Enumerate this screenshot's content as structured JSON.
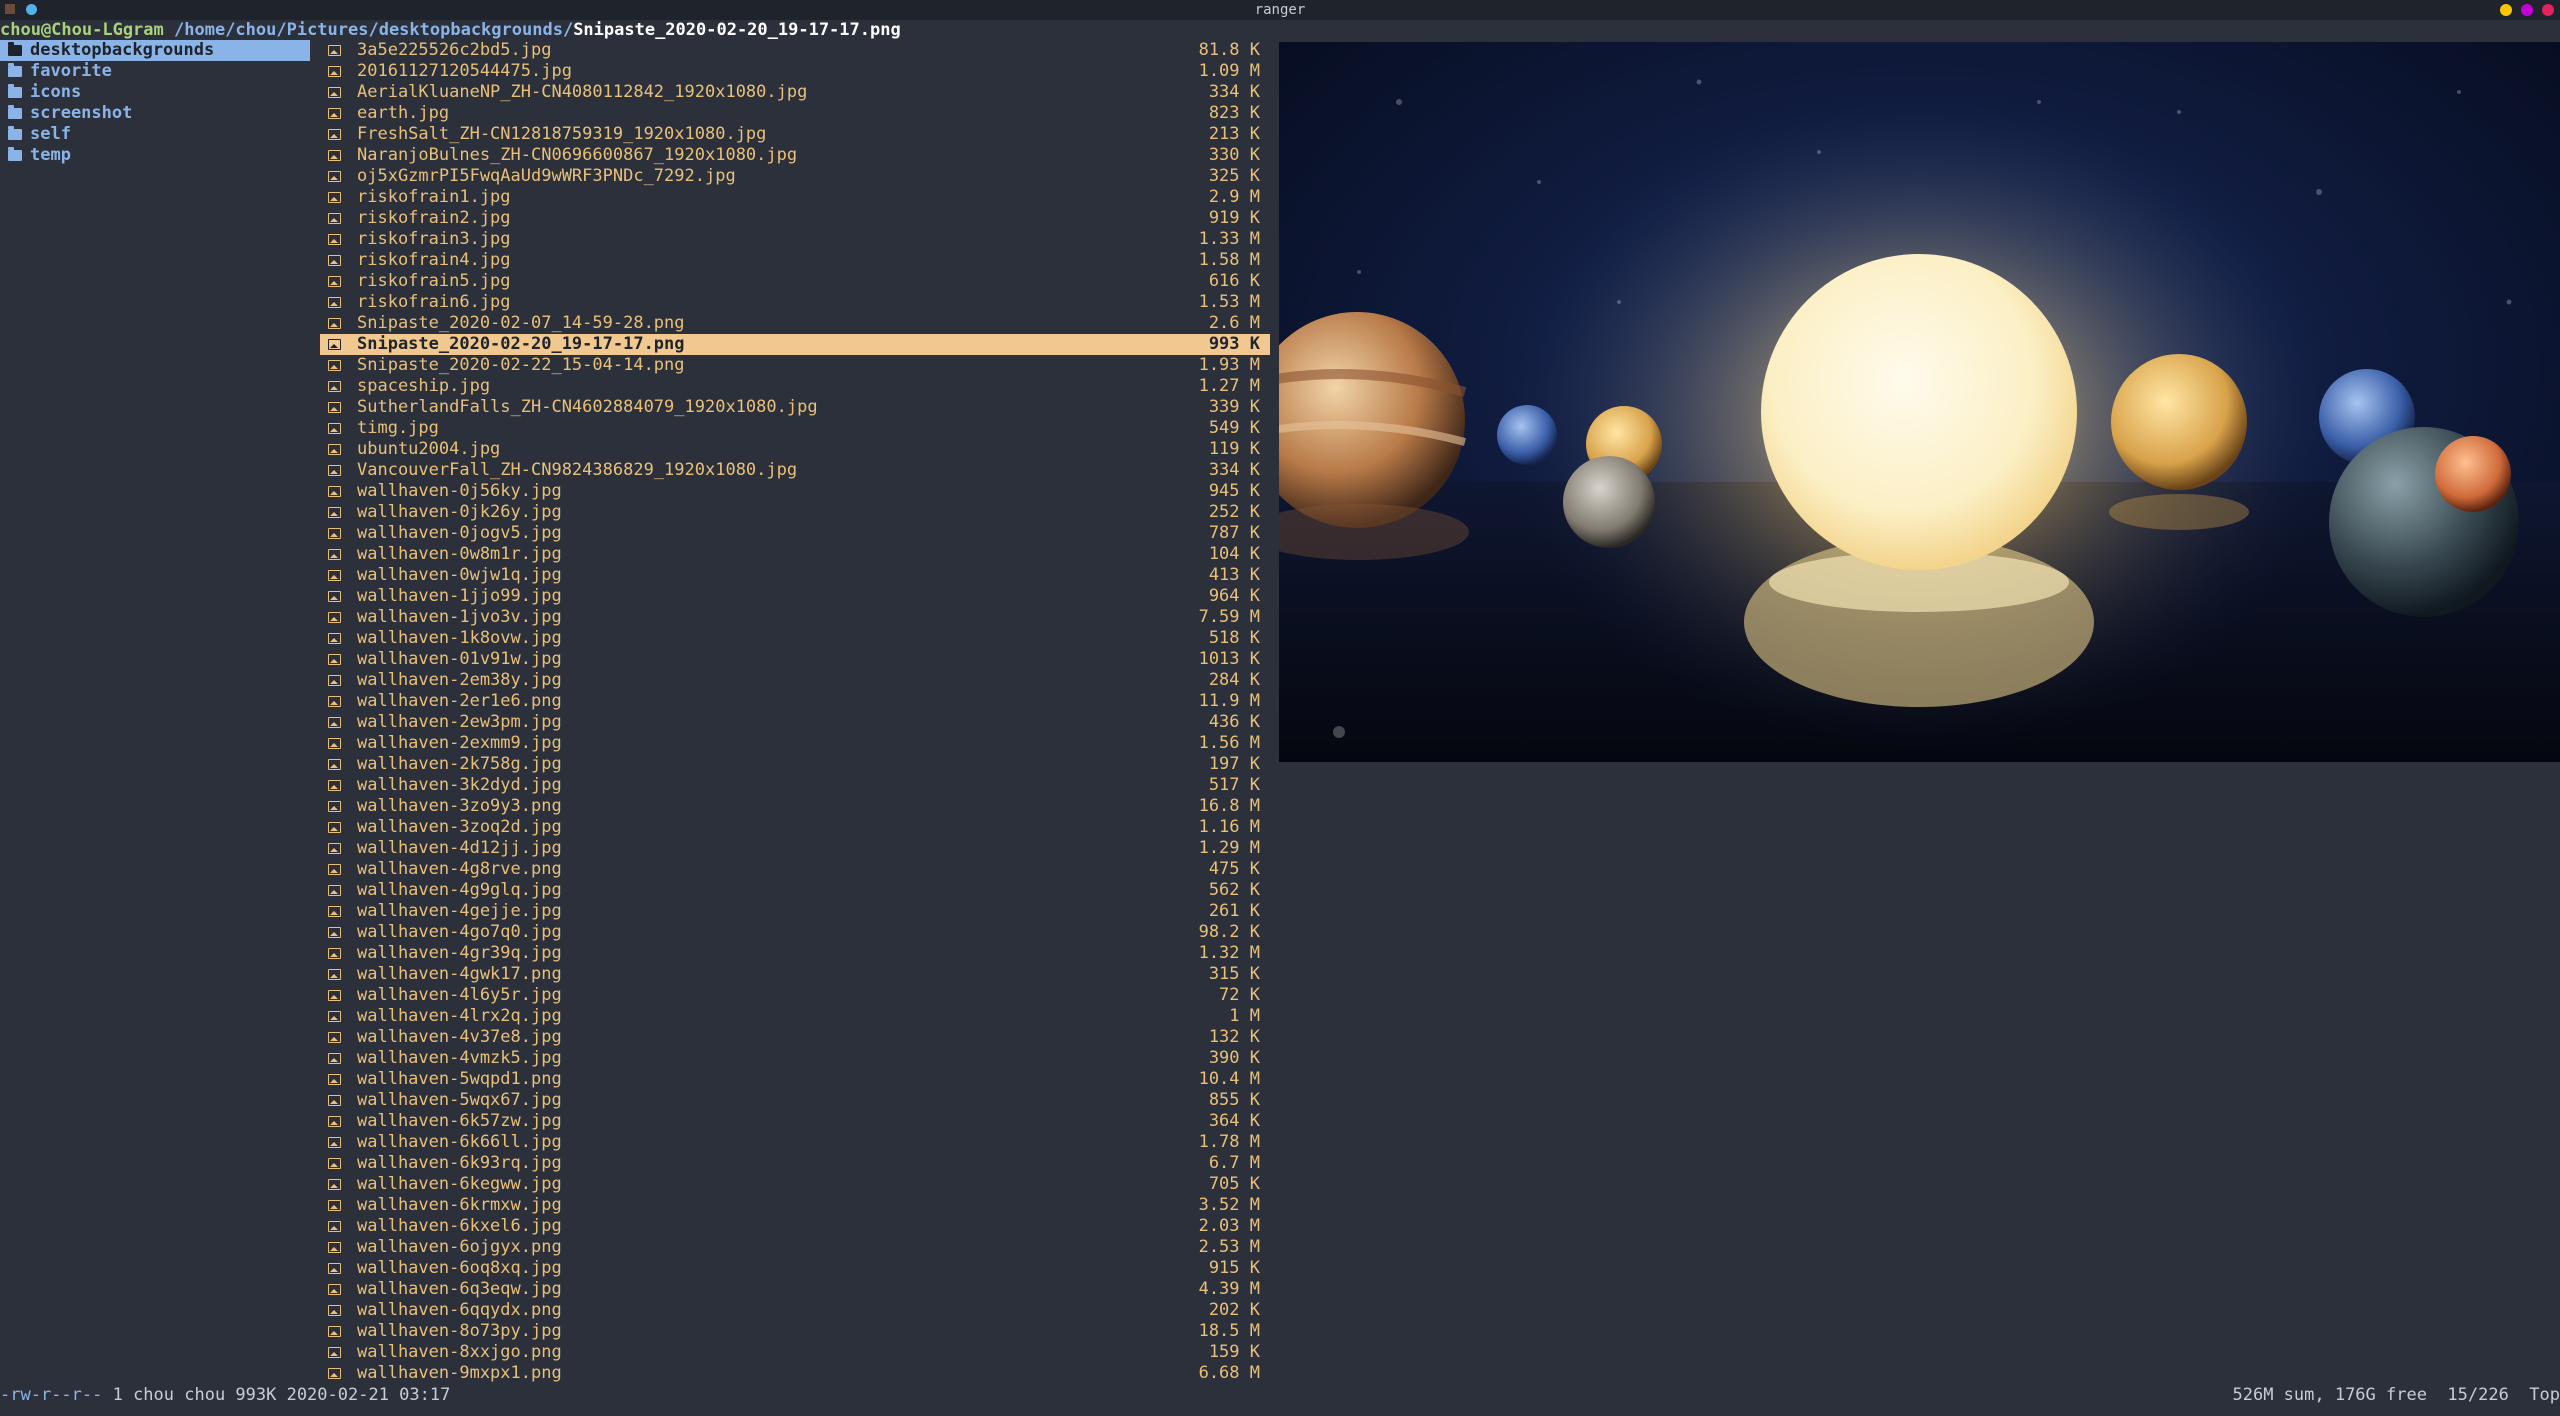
{
  "window": {
    "title": "ranger",
    "controls": [
      {
        "name": "minimize",
        "color": "#f7c600"
      },
      {
        "name": "maximize",
        "color": "#c400d8"
      },
      {
        "name": "close",
        "color": "#e0245e"
      }
    ]
  },
  "path": {
    "host": "chou@Chou-LGgram",
    "dir": "/home/chou/Pictures/desktopbackgrounds/",
    "file": "Snipaste_2020-02-20_19-17-17.png"
  },
  "parent_dirs": [
    {
      "name": "desktopbackgrounds",
      "selected": true
    },
    {
      "name": "favorite",
      "selected": false
    },
    {
      "name": "icons",
      "selected": false
    },
    {
      "name": "screenshot",
      "selected": false
    },
    {
      "name": "self",
      "selected": false
    },
    {
      "name": "temp",
      "selected": false
    }
  ],
  "files": [
    {
      "name": "3a5e225526c2bd5.jpg",
      "size": "81.8 K"
    },
    {
      "name": "20161127120544475.jpg",
      "size": "1.09 M"
    },
    {
      "name": "AerialKluaneNP_ZH-CN4080112842_1920x1080.jpg",
      "size": "334 K"
    },
    {
      "name": "earth.jpg",
      "size": "823 K"
    },
    {
      "name": "FreshSalt_ZH-CN12818759319_1920x1080.jpg",
      "size": "213 K"
    },
    {
      "name": "NaranjoBulnes_ZH-CN0696600867_1920x1080.jpg",
      "size": "330 K"
    },
    {
      "name": "oj5xGzmrPI5FwqAaUd9wWRF3PNDc_7292.jpg",
      "size": "325 K"
    },
    {
      "name": "riskofrain1.jpg",
      "size": "2.9 M"
    },
    {
      "name": "riskofrain2.jpg",
      "size": "919 K"
    },
    {
      "name": "riskofrain3.jpg",
      "size": "1.33 M"
    },
    {
      "name": "riskofrain4.jpg",
      "size": "1.58 M"
    },
    {
      "name": "riskofrain5.jpg",
      "size": "616 K"
    },
    {
      "name": "riskofrain6.jpg",
      "size": "1.53 M"
    },
    {
      "name": "Snipaste_2020-02-07_14-59-28.png",
      "size": "2.6 M"
    },
    {
      "name": "Snipaste_2020-02-20_19-17-17.png",
      "size": "993 K",
      "selected": true
    },
    {
      "name": "Snipaste_2020-02-22_15-04-14.png",
      "size": "1.93 M"
    },
    {
      "name": "spaceship.jpg",
      "size": "1.27 M"
    },
    {
      "name": "SutherlandFalls_ZH-CN4602884079_1920x1080.jpg",
      "size": "339 K"
    },
    {
      "name": "timg.jpg",
      "size": "549 K"
    },
    {
      "name": "ubuntu2004.jpg",
      "size": "119 K"
    },
    {
      "name": "VancouverFall_ZH-CN9824386829_1920x1080.jpg",
      "size": "334 K"
    },
    {
      "name": "wallhaven-0j56ky.jpg",
      "size": "945 K"
    },
    {
      "name": "wallhaven-0jk26y.jpg",
      "size": "252 K"
    },
    {
      "name": "wallhaven-0jogv5.jpg",
      "size": "787 K"
    },
    {
      "name": "wallhaven-0w8m1r.jpg",
      "size": "104 K"
    },
    {
      "name": "wallhaven-0wjw1q.jpg",
      "size": "413 K"
    },
    {
      "name": "wallhaven-1jjo99.jpg",
      "size": "964 K"
    },
    {
      "name": "wallhaven-1jvo3v.jpg",
      "size": "7.59 M"
    },
    {
      "name": "wallhaven-1k8ovw.jpg",
      "size": "518 K"
    },
    {
      "name": "wallhaven-01v91w.jpg",
      "size": "1013 K"
    },
    {
      "name": "wallhaven-2em38y.jpg",
      "size": "284 K"
    },
    {
      "name": "wallhaven-2er1e6.png",
      "size": "11.9 M"
    },
    {
      "name": "wallhaven-2ew3pm.jpg",
      "size": "436 K"
    },
    {
      "name": "wallhaven-2exmm9.jpg",
      "size": "1.56 M"
    },
    {
      "name": "wallhaven-2k758g.jpg",
      "size": "197 K"
    },
    {
      "name": "wallhaven-3k2dyd.jpg",
      "size": "517 K"
    },
    {
      "name": "wallhaven-3zo9y3.png",
      "size": "16.8 M"
    },
    {
      "name": "wallhaven-3zoq2d.jpg",
      "size": "1.16 M"
    },
    {
      "name": "wallhaven-4d12jj.jpg",
      "size": "1.29 M"
    },
    {
      "name": "wallhaven-4g8rve.png",
      "size": "475 K"
    },
    {
      "name": "wallhaven-4g9glq.jpg",
      "size": "562 K"
    },
    {
      "name": "wallhaven-4gejje.jpg",
      "size": "261 K"
    },
    {
      "name": "wallhaven-4go7q0.jpg",
      "size": "98.2 K"
    },
    {
      "name": "wallhaven-4gr39q.jpg",
      "size": "1.32 M"
    },
    {
      "name": "wallhaven-4gwk17.png",
      "size": "315 K"
    },
    {
      "name": "wallhaven-4l6y5r.jpg",
      "size": "72 K"
    },
    {
      "name": "wallhaven-4lrx2q.jpg",
      "size": "1 M"
    },
    {
      "name": "wallhaven-4v37e8.jpg",
      "size": "132 K"
    },
    {
      "name": "wallhaven-4vmzk5.jpg",
      "size": "390 K"
    },
    {
      "name": "wallhaven-5wqpd1.png",
      "size": "10.4 M"
    },
    {
      "name": "wallhaven-5wqx67.jpg",
      "size": "855 K"
    },
    {
      "name": "wallhaven-6k57zw.jpg",
      "size": "364 K"
    },
    {
      "name": "wallhaven-6k66ll.jpg",
      "size": "1.78 M"
    },
    {
      "name": "wallhaven-6k93rq.jpg",
      "size": "6.7 M"
    },
    {
      "name": "wallhaven-6kegww.jpg",
      "size": "705 K"
    },
    {
      "name": "wallhaven-6krmxw.jpg",
      "size": "3.52 M"
    },
    {
      "name": "wallhaven-6kxel6.jpg",
      "size": "2.03 M"
    },
    {
      "name": "wallhaven-6ojgyx.png",
      "size": "2.53 M"
    },
    {
      "name": "wallhaven-6oq8xq.jpg",
      "size": "915 K"
    },
    {
      "name": "wallhaven-6q3eqw.jpg",
      "size": "4.39 M"
    },
    {
      "name": "wallhaven-6qqydx.png",
      "size": "202 K"
    },
    {
      "name": "wallhaven-8o73py.jpg",
      "size": "18.5 M"
    },
    {
      "name": "wallhaven-8xxjgo.png",
      "size": "159 K"
    },
    {
      "name": "wallhaven-9mxpx1.png",
      "size": "6.68 M"
    }
  ],
  "status": {
    "permissions": "-rw-r--r--",
    "info": " 1 chou chou 993K 2020-02-21 03:17",
    "summary": "526M sum, 176G free  15/226  Top"
  },
  "preview_icon": "planets-image"
}
